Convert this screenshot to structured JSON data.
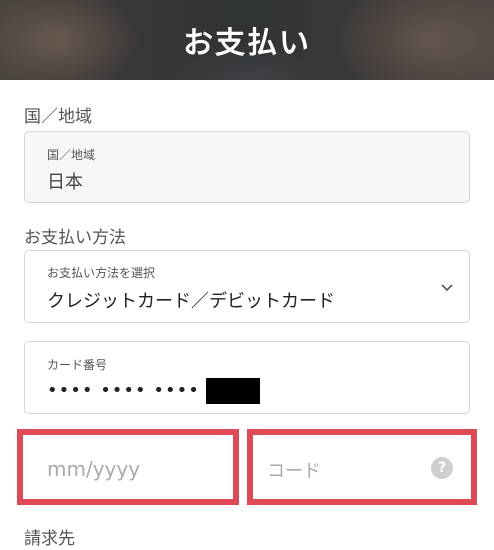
{
  "header": {
    "title": "お支払い"
  },
  "country_section": {
    "label": "国／地域",
    "field_label": "国／地域",
    "field_value": "日本"
  },
  "payment_method_section": {
    "label": "お支払い方法",
    "select_label": "お支払い方法を選択",
    "selected_value": "クレジットカード／デビットカード"
  },
  "card_number": {
    "label": "カード番号",
    "masked_value": "•••• •••• ••••"
  },
  "expiry": {
    "placeholder": "mm/yyyy"
  },
  "security_code": {
    "placeholder": "コード",
    "help_icon": "?"
  },
  "billing_section": {
    "label": "請求先"
  },
  "colors": {
    "highlight": "#e04a57"
  }
}
